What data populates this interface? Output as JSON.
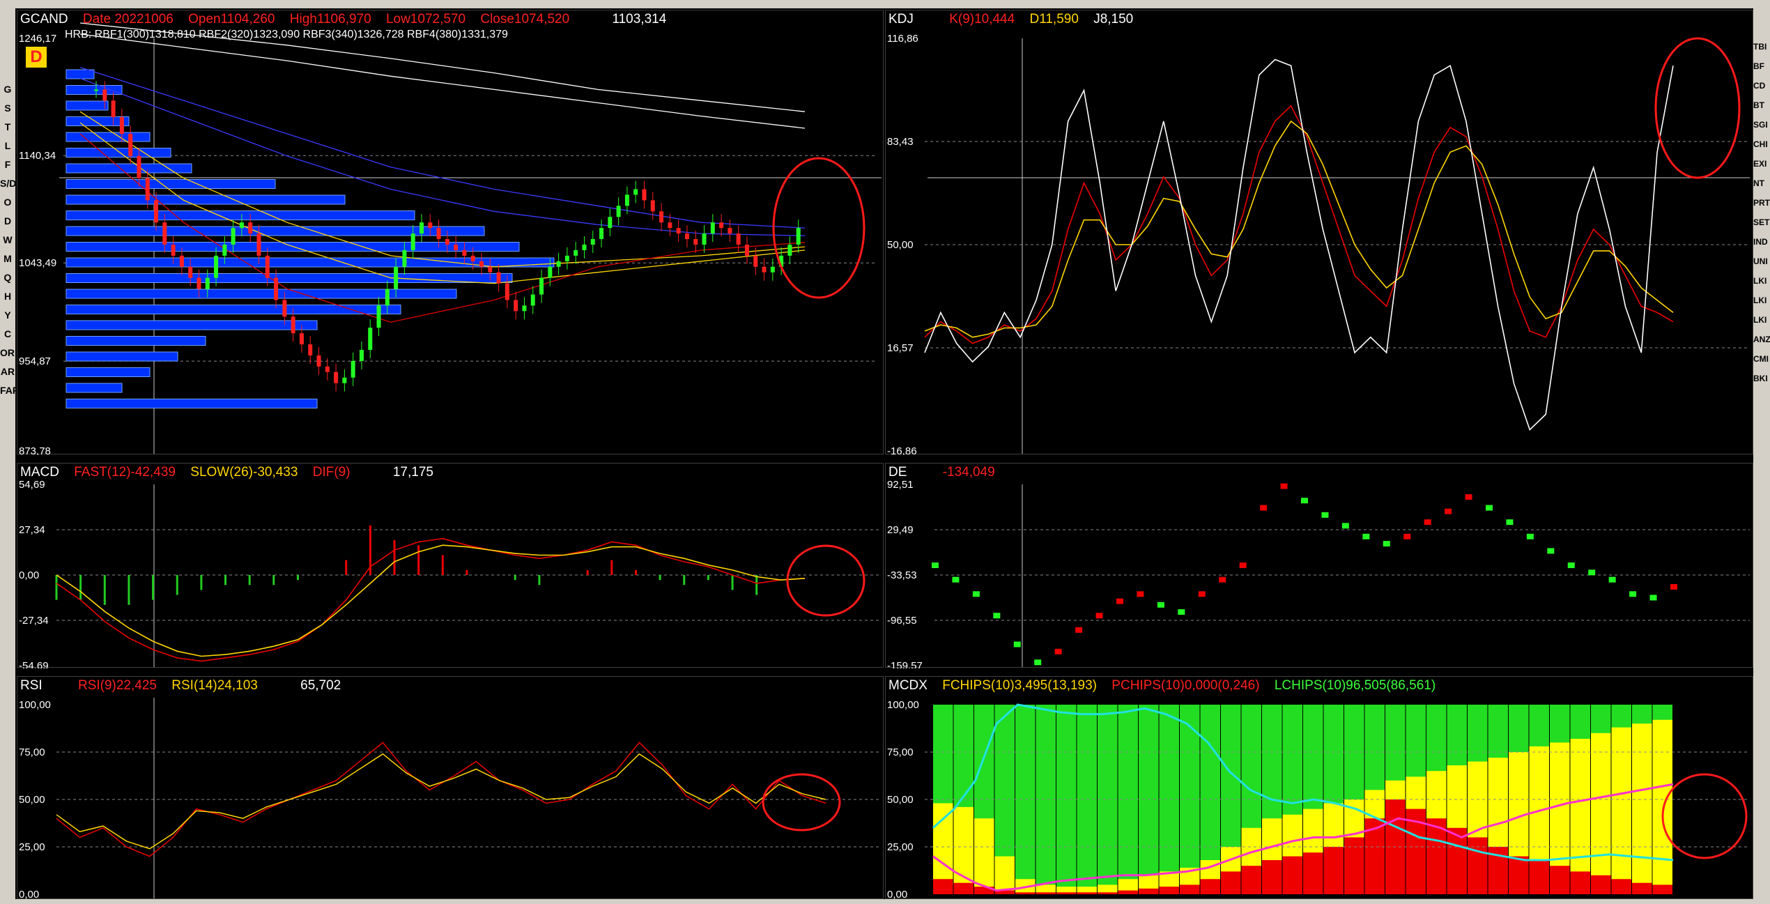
{
  "toolbar": {
    "left": [
      "G",
      "S",
      "T",
      "L",
      "F",
      "S/D",
      "O",
      "D",
      "W",
      "M",
      "Q",
      "H",
      "Y",
      "C",
      "ORD",
      "AR",
      "FAR"
    ],
    "right": [
      "TBI",
      "BF",
      "CD",
      "BT",
      "SGI",
      "CHI",
      "EXI",
      "NT",
      "PRT",
      "SET",
      "IND",
      "UNI",
      "LKI",
      "LKI",
      "LKI",
      "ANZ",
      "CMI",
      "BKI"
    ]
  },
  "panels": {
    "price": {
      "name": "GCAND",
      "date": "Date 20221006",
      "open": "Open1104,260",
      "high": "High1106,970",
      "low": "Low1072,570",
      "close": "Close1074,520",
      "cursor": "1103,314",
      "yticks": [
        "1246,17",
        "1140,34",
        "1043,49",
        "954,87",
        "873,78"
      ],
      "hrb": "HRB: RBF1(300)1318,810  RBF2(320)1323,090  RBF3(340)1326,728  RBF4(380)1331,379",
      "badge": "D"
    },
    "kdj": {
      "name": "KDJ",
      "k": "K(9)10,444",
      "d": "D11,590",
      "j": "J8,150",
      "yticks": [
        "116,86",
        "83,43",
        "50,00",
        "16,57",
        "-16,86"
      ]
    },
    "macd": {
      "name": "MACD",
      "fast": "FAST(12)-42,439",
      "slow": "SLOW(26)-30,433",
      "dif": "DIF(9)",
      "value": "17,175",
      "yticks": [
        "54,69",
        "27,34",
        "0,00",
        "-27,34",
        "-54,69"
      ]
    },
    "de": {
      "name": "DE",
      "value": "-134,049",
      "yticks": [
        "92,51",
        "29,49",
        "-33,53",
        "-96,55",
        "-159,57"
      ]
    },
    "rsi": {
      "name": "RSI",
      "rsi9": "RSI(9)22,425",
      "rsi14": "RSI(14)24,103",
      "value": "65,702",
      "yticks": [
        "100,00",
        "75,00",
        "50,00",
        "25,00",
        "0,00"
      ]
    },
    "mcdx": {
      "name": "MCDX",
      "fchips": "FCHIPS(10)3,495(13,193)",
      "pchips": "PCHIPS(10)0,000(0,246)",
      "lchips": "LCHIPS(10)96,505(86,561)",
      "yticks": [
        "100,00",
        "75,00",
        "50,00",
        "25,00",
        "0,00"
      ]
    }
  },
  "chart_data": [
    {
      "type": "candlestick",
      "title": "GCAND",
      "ylim": [
        873.78,
        1246.17
      ],
      "close_series": [
        1200,
        1190,
        1175,
        1160,
        1140,
        1120,
        1100,
        1080,
        1060,
        1050,
        1040,
        1030,
        1020,
        1030,
        1050,
        1060,
        1075,
        1080,
        1070,
        1050,
        1030,
        1010,
        995,
        980,
        970,
        960,
        950,
        945,
        935,
        940,
        955,
        965,
        985,
        1005,
        1020,
        1040,
        1055,
        1070,
        1080,
        1075,
        1065,
        1060,
        1055,
        1050,
        1045,
        1040,
        1035,
        1025,
        1010,
        1000,
        1005,
        1015,
        1030,
        1040,
        1045,
        1050,
        1055,
        1060,
        1065,
        1075,
        1085,
        1095,
        1105,
        1110,
        1100,
        1090,
        1080,
        1075,
        1070,
        1065,
        1060,
        1070,
        1080,
        1075,
        1070,
        1060,
        1050,
        1040,
        1035,
        1040,
        1050,
        1060,
        1075
      ]
    },
    {
      "type": "line",
      "title": "KDJ",
      "ylim": [
        -16.86,
        116.86
      ],
      "series": [
        {
          "name": "K",
          "values": [
            20,
            25,
            22,
            18,
            20,
            24,
            22,
            26,
            35,
            55,
            70,
            60,
            45,
            50,
            60,
            72,
            65,
            50,
            40,
            45,
            60,
            80,
            90,
            95,
            85,
            70,
            55,
            40,
            35,
            30,
            45,
            65,
            80,
            88,
            85,
            72,
            55,
            35,
            22,
            20,
            30,
            45,
            55,
            50,
            40,
            30,
            28,
            25
          ]
        },
        {
          "name": "D",
          "values": [
            22,
            24,
            23,
            20,
            21,
            23,
            23,
            24,
            30,
            45,
            58,
            58,
            50,
            50,
            56,
            65,
            64,
            55,
            47,
            46,
            55,
            70,
            82,
            90,
            86,
            76,
            63,
            50,
            42,
            36,
            40,
            55,
            70,
            80,
            82,
            76,
            63,
            47,
            33,
            26,
            28,
            38,
            48,
            48,
            43,
            36,
            32,
            28
          ]
        },
        {
          "name": "J",
          "values": [
            15,
            28,
            18,
            12,
            17,
            28,
            20,
            32,
            50,
            90,
            100,
            70,
            35,
            50,
            70,
            90,
            66,
            40,
            25,
            40,
            75,
            105,
            110,
            108,
            80,
            55,
            35,
            15,
            20,
            15,
            55,
            90,
            105,
            108,
            90,
            60,
            30,
            5,
            -10,
            -5,
            30,
            60,
            75,
            55,
            30,
            15,
            80,
            108
          ]
        }
      ]
    },
    {
      "type": "line",
      "title": "MACD",
      "ylim": [
        -54.69,
        54.69
      ],
      "series": [
        {
          "name": "FAST",
          "values": [
            -5,
            -15,
            -28,
            -38,
            -45,
            -50,
            -52,
            -50,
            -48,
            -45,
            -40,
            -30,
            -15,
            5,
            15,
            20,
            22,
            18,
            15,
            12,
            10,
            12,
            15,
            20,
            18,
            12,
            8,
            5,
            0,
            -5,
            -3,
            -2
          ]
        },
        {
          "name": "SLOW",
          "values": [
            0,
            -10,
            -22,
            -32,
            -40,
            -46,
            -49,
            -48,
            -46,
            -43,
            -39,
            -30,
            -18,
            -5,
            8,
            14,
            18,
            17,
            15,
            13,
            12,
            12,
            14,
            17,
            17,
            13,
            10,
            6,
            3,
            -1,
            -3,
            -2
          ]
        }
      ]
    },
    {
      "type": "line",
      "title": "DE",
      "ylim": [
        -159.57,
        92.51
      ],
      "series": [
        {
          "name": "DE",
          "values": [
            -20,
            -40,
            -60,
            -90,
            -130,
            -155,
            -140,
            -110,
            -90,
            -70,
            -60,
            -75,
            -85,
            -60,
            -40,
            -20,
            60,
            90,
            70,
            50,
            35,
            20,
            10,
            20,
            40,
            55,
            75,
            60,
            40,
            20,
            0,
            -20,
            -30,
            -40,
            -60,
            -65,
            -50
          ]
        }
      ]
    },
    {
      "type": "line",
      "title": "RSI",
      "ylim": [
        0,
        100
      ],
      "series": [
        {
          "name": "RSI(9)",
          "values": [
            40,
            30,
            35,
            25,
            20,
            30,
            45,
            42,
            38,
            45,
            50,
            55,
            60,
            70,
            80,
            65,
            55,
            62,
            70,
            60,
            55,
            48,
            50,
            58,
            65,
            80,
            68,
            52,
            45,
            58,
            45,
            60,
            52,
            48
          ]
        },
        {
          "name": "RSI(14)",
          "values": [
            42,
            33,
            36,
            28,
            24,
            32,
            44,
            43,
            40,
            46,
            50,
            54,
            58,
            66,
            74,
            64,
            57,
            61,
            66,
            60,
            56,
            50,
            51,
            57,
            62,
            74,
            66,
            54,
            48,
            56,
            48,
            58,
            53,
            50
          ]
        }
      ]
    },
    {
      "type": "area",
      "title": "MCDX",
      "ylim": [
        0,
        100
      ],
      "series": [
        {
          "name": "FCHIPS",
          "values": [
            48,
            46,
            40,
            20,
            8,
            5,
            4,
            4,
            5,
            8,
            10,
            12,
            14,
            18,
            25,
            35,
            40,
            42,
            45,
            48,
            50,
            55,
            60,
            62,
            65,
            68,
            70,
            72,
            75,
            78,
            80,
            82,
            85,
            88,
            90,
            92
          ]
        },
        {
          "name": "PCHIPS",
          "values": [
            8,
            6,
            4,
            2,
            1,
            1,
            1,
            1,
            1,
            2,
            3,
            4,
            5,
            8,
            12,
            15,
            18,
            20,
            22,
            25,
            30,
            40,
            50,
            45,
            40,
            35,
            30,
            25,
            20,
            18,
            15,
            12,
            10,
            8,
            6,
            5
          ]
        }
      ]
    }
  ]
}
